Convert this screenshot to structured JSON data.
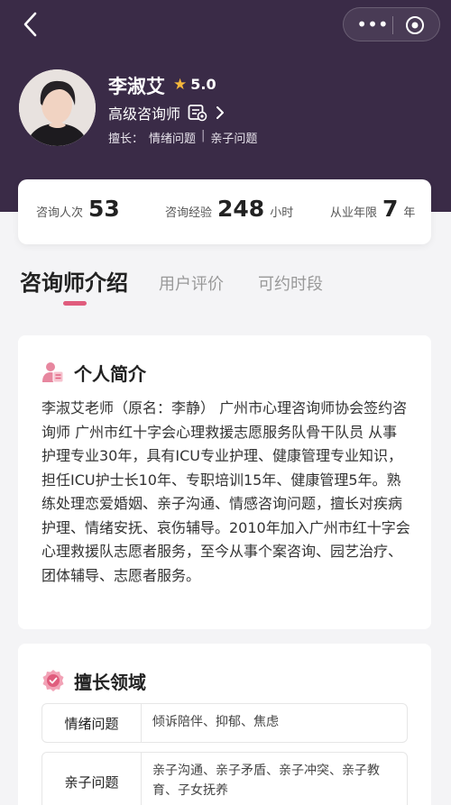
{
  "profile": {
    "name": "李淑艾",
    "rating": "5.0",
    "title": "高级咨询师",
    "specialty_label": "擅长：",
    "specialties": [
      "情绪问题",
      "亲子问题"
    ],
    "separator": "|"
  },
  "stats": [
    {
      "label": "咨询人次",
      "value": "53",
      "unit": ""
    },
    {
      "label": "咨询经验",
      "value": "248",
      "unit": "小时"
    },
    {
      "label": "从业年限",
      "value": "7",
      "unit": "年"
    }
  ],
  "tabs": [
    "咨询师介绍",
    "用户评价",
    "可约时段"
  ],
  "intro": {
    "heading": "个人简介",
    "text": "李淑艾老师（原名：李静） 广州市心理咨询师协会签约咨询师 广州市红十字会心理救援志愿服务队骨干队员 从事护理专业30年，具有ICU专业护理、健康管理专业知识，担任ICU护士长10年、专职培训15年、健康管理5年。熟练处理恋爱婚姻、亲子沟通、情感咨询问题，擅长对疾病护理、情绪安抚、哀伤辅导。2010年加入广州市红十字会心理救援队志愿者服务，至今从事个案咨询、园艺治疗、团体辅导、志愿者服务。"
  },
  "expertise": {
    "heading": "擅长领域",
    "rows": [
      {
        "category": "情绪问题",
        "items": "倾诉陪伴、抑郁、焦虑"
      },
      {
        "category": "亲子问题",
        "items": "亲子沟通、亲子矛盾、亲子冲突、亲子教育、子女抚养"
      }
    ]
  },
  "colors": {
    "header_bg": "#3a2b47",
    "accent": "#e05c7d",
    "star": "#f5b73b"
  },
  "icons": {
    "back": "back-icon",
    "more": "more-icon",
    "close": "target-icon",
    "cert": "certificate-icon",
    "chevron": "chevron-right-icon",
    "intro": "profile-icon",
    "expertise": "badge-icon"
  }
}
